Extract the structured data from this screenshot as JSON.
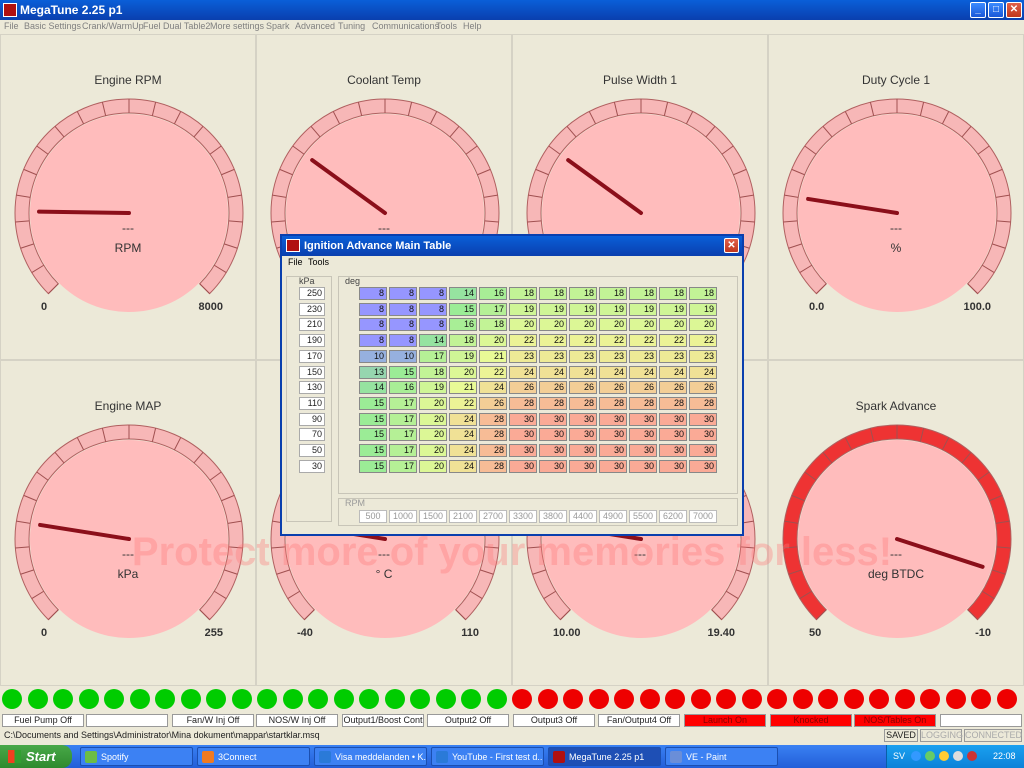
{
  "window": {
    "title": "MegaTune 2.25 p1",
    "min": "_",
    "max": "□",
    "close": "✕"
  },
  "menu": [
    "File",
    "Basic Settings",
    "Crank/WarmUp",
    "Fuel Dual Table2",
    "More settings",
    "Spark",
    "Advanced",
    "Tuning",
    "Communications",
    "Tools",
    "Help"
  ],
  "gauges": [
    {
      "title": "Engine RPM",
      "unit": "RPM",
      "value": "---",
      "min": "0",
      "max": "8000",
      "needle": 0.17,
      "ring": "pink"
    },
    {
      "title": "Coolant Temp",
      "unit": "",
      "value": "---",
      "min": "",
      "max": "",
      "needle": 0.3,
      "ring": "pink"
    },
    {
      "title": "Pulse Width 1",
      "unit": "",
      "value": "",
      "min": "",
      "max": "",
      "needle": 0.3,
      "ring": "pink"
    },
    {
      "title": "Duty Cycle 1",
      "unit": "%",
      "value": "---",
      "min": "0.0",
      "max": "100.0",
      "needle": 0.2,
      "ring": "pink"
    },
    {
      "title": "Engine MAP",
      "unit": "kPa",
      "value": "---",
      "min": "0",
      "max": "255",
      "needle": 0.2,
      "ring": "pink"
    },
    {
      "title": "",
      "unit": "° C",
      "value": "---",
      "min": "-40",
      "max": "110",
      "needle": 0.2,
      "ring": "pink"
    },
    {
      "title": "",
      "unit": "",
      "value": "---",
      "min": "10.00",
      "max": "19.40",
      "needle": 0.2,
      "ring": "pink"
    },
    {
      "title": "Spark Advance",
      "unit": "deg BTDC",
      "value": "---",
      "min": "50",
      "max": "-10",
      "needle": 0.9,
      "ring": "red"
    }
  ],
  "status": {
    "labels": [
      "Fuel Pump Off",
      "",
      "Fan/W Inj Off",
      "NOS/W Inj Off",
      "Output1/Boost Cont",
      "Output2 Off",
      "Output3 Off",
      "Fan/Output4 Off",
      "Launch On",
      "Knocked",
      "NOS/Tables On",
      ""
    ],
    "red": [
      false,
      false,
      false,
      false,
      false,
      false,
      false,
      false,
      true,
      true,
      true,
      false
    ],
    "path": "C:\\Documents and Settings\\Administrator\\Mina dokument\\mappar\\startklar.msq",
    "flags": [
      "SAVED",
      "LOGGING",
      "CONNECTED"
    ],
    "green_color": "#00cc00",
    "red_color": "#ee0000"
  },
  "dialog": {
    "title": "Ignition Advance Main Table",
    "menu": [
      "File",
      "Tools"
    ],
    "kpa_label": "kPa",
    "deg_label": "deg",
    "rpm_label": "RPM",
    "kpa": [
      "250",
      "230",
      "210",
      "190",
      "170",
      "150",
      "130",
      "110",
      "90",
      "70",
      "50",
      "30"
    ],
    "rpm": [
      "500",
      "1000",
      "1500",
      "2100",
      "2700",
      "3300",
      "3800",
      "4400",
      "4900",
      "5500",
      "6200",
      "7000"
    ],
    "table": [
      [
        "8",
        "8",
        "8",
        "14",
        "16",
        "18",
        "18",
        "18",
        "18",
        "18",
        "18",
        "18"
      ],
      [
        "8",
        "8",
        "8",
        "15",
        "17",
        "19",
        "19",
        "19",
        "19",
        "19",
        "19",
        "19"
      ],
      [
        "8",
        "8",
        "8",
        "16",
        "18",
        "20",
        "20",
        "20",
        "20",
        "20",
        "20",
        "20"
      ],
      [
        "8",
        "8",
        "14",
        "18",
        "20",
        "22",
        "22",
        "22",
        "22",
        "22",
        "22",
        "22"
      ],
      [
        "10",
        "10",
        "17",
        "19",
        "21",
        "23",
        "23",
        "23",
        "23",
        "23",
        "23",
        "23"
      ],
      [
        "13",
        "15",
        "18",
        "20",
        "22",
        "24",
        "24",
        "24",
        "24",
        "24",
        "24",
        "24"
      ],
      [
        "14",
        "16",
        "19",
        "21",
        "24",
        "26",
        "26",
        "26",
        "26",
        "26",
        "26",
        "26"
      ],
      [
        "15",
        "17",
        "20",
        "22",
        "26",
        "28",
        "28",
        "28",
        "28",
        "28",
        "28",
        "28"
      ],
      [
        "15",
        "17",
        "20",
        "24",
        "28",
        "30",
        "30",
        "30",
        "30",
        "30",
        "30",
        "30"
      ],
      [
        "15",
        "17",
        "20",
        "24",
        "28",
        "30",
        "30",
        "30",
        "30",
        "30",
        "30",
        "30"
      ],
      [
        "15",
        "17",
        "20",
        "24",
        "28",
        "30",
        "30",
        "30",
        "30",
        "30",
        "30",
        "30"
      ],
      [
        "15",
        "17",
        "20",
        "24",
        "28",
        "30",
        "30",
        "30",
        "30",
        "30",
        "30",
        "30"
      ]
    ]
  },
  "watermark": "Protect more of your memories for less!",
  "taskbar": {
    "start": "Start",
    "tasks": [
      "Spotify",
      "3Connect",
      "Visa meddelanden • K...",
      "YouTube - First test d...",
      "MegaTune 2.25 p1",
      "VE - Paint"
    ],
    "active": 4,
    "lang": "SV",
    "clock": "22:08"
  }
}
